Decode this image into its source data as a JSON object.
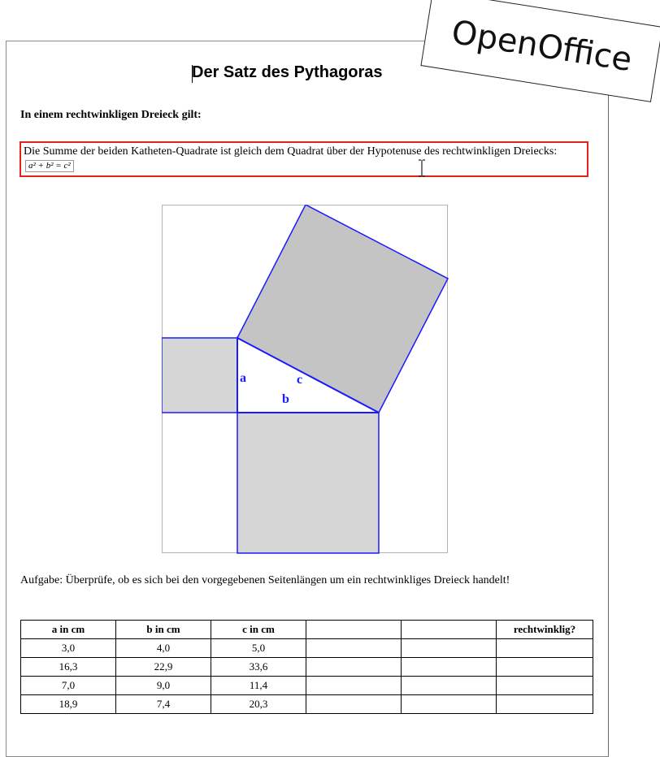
{
  "document": {
    "title": "Der Satz des Pythagoras",
    "subheading": "In einem rechtwinkligen Dreieck gilt:",
    "statement": "Die Summe der beiden Katheten-Quadrate ist gleich dem Quadrat über der Hypotenuse des rechtwinkligen Dreiecks:",
    "formula": "a² + b² = c²",
    "task": "Aufgabe: Überprüfe, ob es sich bei den vorgegebenen Seitenlängen um ein rechtwinkliges Dreieck handelt!"
  },
  "figure": {
    "label_a": "a",
    "label_b": "b",
    "label_c": "c"
  },
  "table": {
    "headers": [
      "a in cm",
      "b in cm",
      "c in cm",
      "",
      "",
      "rechtwinklig?"
    ],
    "rows": [
      [
        "3,0",
        "4,0",
        "5,0",
        "",
        "",
        ""
      ],
      [
        "16,3",
        "22,9",
        "33,6",
        "",
        "",
        ""
      ],
      [
        "7,0",
        "9,0",
        "11,4",
        "",
        "",
        ""
      ],
      [
        "18,9",
        "7,4",
        "20,3",
        "",
        "",
        ""
      ]
    ]
  },
  "badge": {
    "text": "OpenOffice"
  },
  "colors": {
    "highlight_border": "#e32222",
    "figure_stroke": "#1a1aff",
    "square_fill": "#c4c4c4"
  }
}
